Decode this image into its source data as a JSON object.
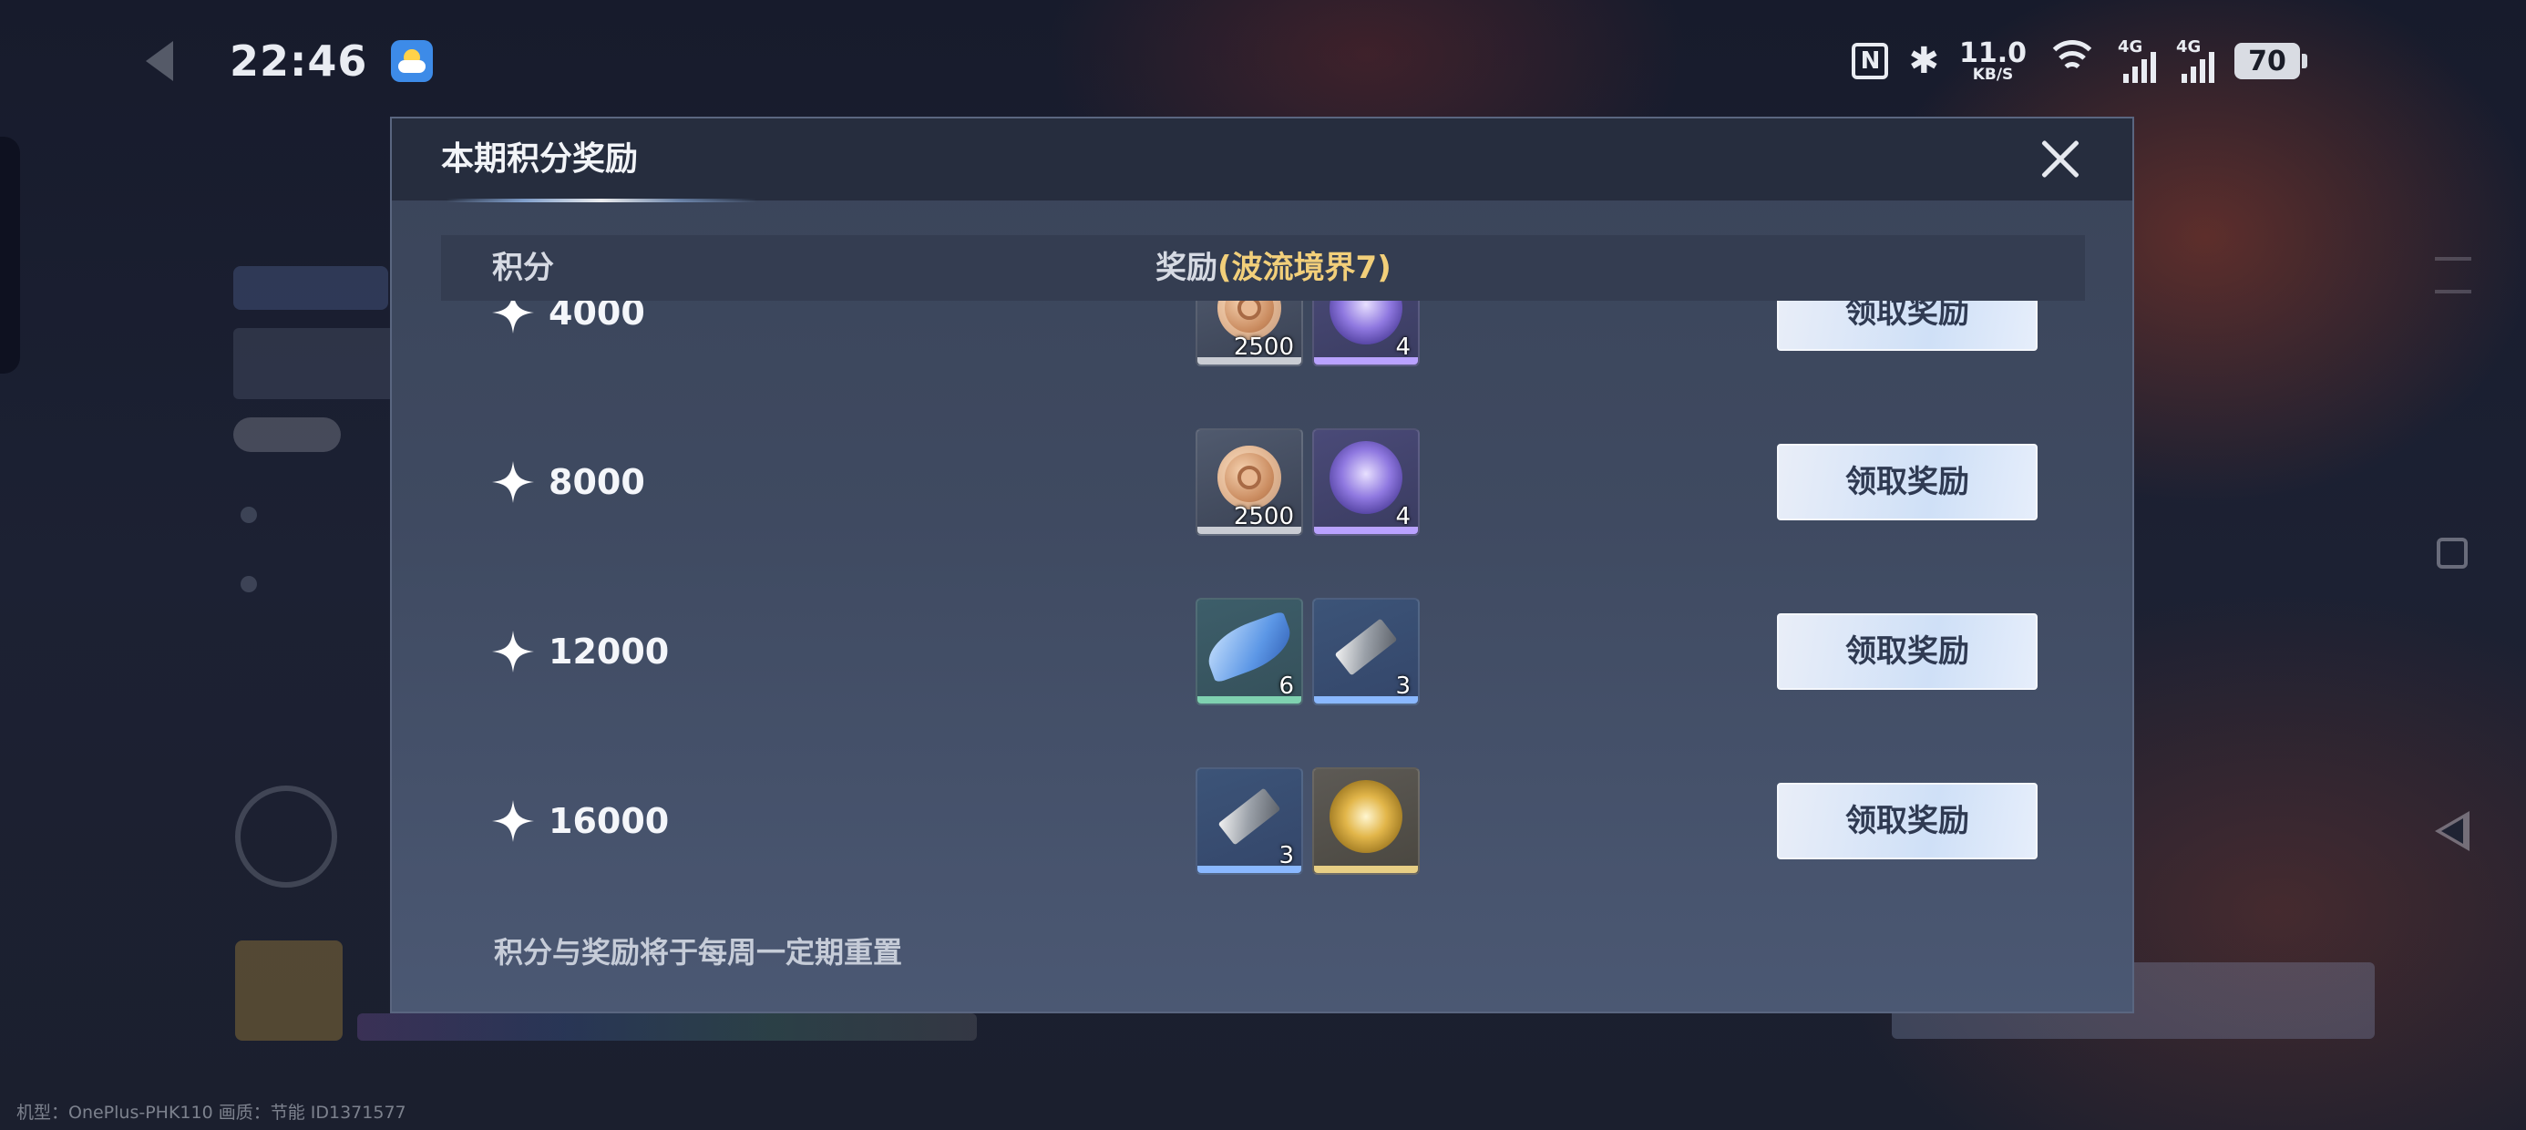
{
  "status_bar": {
    "time": "22:46",
    "nfc_glyph": "N",
    "bluetooth_glyph": "✱",
    "net_speed_value": "11.0",
    "net_speed_unit": "KB/S",
    "sim1_label": "4G",
    "sim2_label": "4G",
    "battery": "70"
  },
  "dialog": {
    "title": "本期积分奖励",
    "header_score": "积分",
    "header_reward": "奖励",
    "header_reward_highlight": "(波流境界7)",
    "claim_label": "领取奖励",
    "footnote": "积分与奖励将于每周一定期重置",
    "rows": [
      {
        "score": "4000",
        "rewards": [
          {
            "icon": "bronze-coin-icon",
            "count": "2500",
            "rarity": "gray"
          },
          {
            "icon": "purple-orb-icon",
            "count": "4",
            "rarity": "purple"
          }
        ]
      },
      {
        "score": "8000",
        "rewards": [
          {
            "icon": "bronze-coin-icon",
            "count": "2500",
            "rarity": "gray"
          },
          {
            "icon": "purple-orb-icon",
            "count": "4",
            "rarity": "purple"
          }
        ]
      },
      {
        "score": "12000",
        "rewards": [
          {
            "icon": "blue-feather-icon",
            "count": "6",
            "rarity": "green"
          },
          {
            "icon": "silver-ingot-icon",
            "count": "3",
            "rarity": "blue"
          }
        ]
      },
      {
        "score": "16000",
        "rewards": [
          {
            "icon": "silver-ingot-icon",
            "count": "3",
            "rarity": "blue"
          },
          {
            "icon": "gold-swirl-icon",
            "count": "",
            "rarity": "gold"
          }
        ]
      }
    ]
  },
  "colors": {
    "reward_highlight": "#f2cf7a",
    "dialog_bg": "#3f4a61",
    "header_bg": "#262d3e",
    "claim_button": "#dbe7f8"
  },
  "watermark": "机型：OnePlus-PHK110 画质：节能 ID1371577"
}
